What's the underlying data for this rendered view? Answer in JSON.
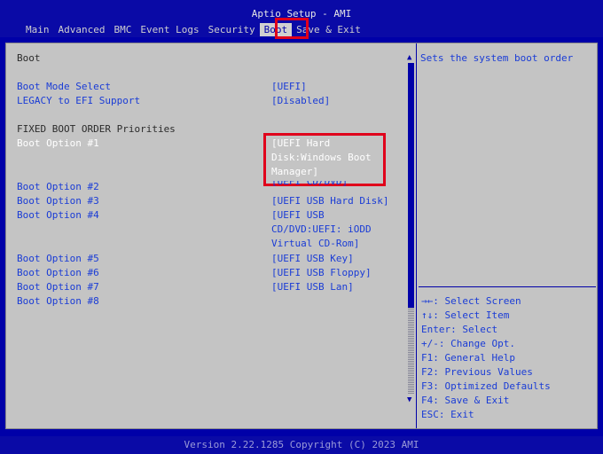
{
  "header": {
    "title": "Aptio Setup - AMI",
    "tabs": [
      "Main",
      "Advanced",
      "BMC",
      "Event Logs",
      "Security",
      "Boot",
      "Save & Exit"
    ],
    "active_tab": "Boot"
  },
  "left": {
    "section_title": "Boot",
    "boot_mode_label": "Boot Mode Select",
    "boot_mode_value": "[UEFI]",
    "legacy_label": "LEGACY to EFI Support",
    "legacy_value": "[Disabled]",
    "priorities_heading": "FIXED BOOT ORDER Priorities",
    "options": [
      {
        "label": "Boot Option #1",
        "value_lines": [
          "[UEFI Hard",
          "Disk:Windows Boot",
          "Manager]"
        ]
      },
      {
        "label": "Boot Option #2",
        "value_lines": [
          "[UEFI CD/DVD]"
        ]
      },
      {
        "label": "Boot Option #3",
        "value_lines": [
          "[UEFI USB Hard Disk]"
        ]
      },
      {
        "label": "Boot Option #4",
        "value_lines": [
          "[UEFI USB",
          "CD/DVD:UEFI: iODD",
          "Virtual CD-Rom]"
        ]
      },
      {
        "label": "Boot Option #5",
        "value_lines": [
          "[UEFI USB Key]"
        ]
      },
      {
        "label": "Boot Option #6",
        "value_lines": [
          "[UEFI USB Floppy]"
        ]
      },
      {
        "label": "Boot Option #7",
        "value_lines": [
          "[UEFI USB Lan]"
        ]
      },
      {
        "label": "Boot Option #8",
        "value_lines": []
      }
    ]
  },
  "help": {
    "description": "Sets the system boot order",
    "keys": [
      "→←: Select Screen",
      "↑↓: Select Item",
      "Enter: Select",
      "+/-: Change Opt.",
      "F1: General Help",
      "F2: Previous Values",
      "F3: Optimized Defaults",
      "F4: Save & Exit",
      "ESC: Exit"
    ]
  },
  "footer": "Version 2.22.1285 Copyright (C) 2023 AMI",
  "colors": {
    "background": "#0000a8",
    "panel": "#c4c4c4",
    "text_blue": "#1a3cd6",
    "highlight_red": "#e0001b"
  }
}
